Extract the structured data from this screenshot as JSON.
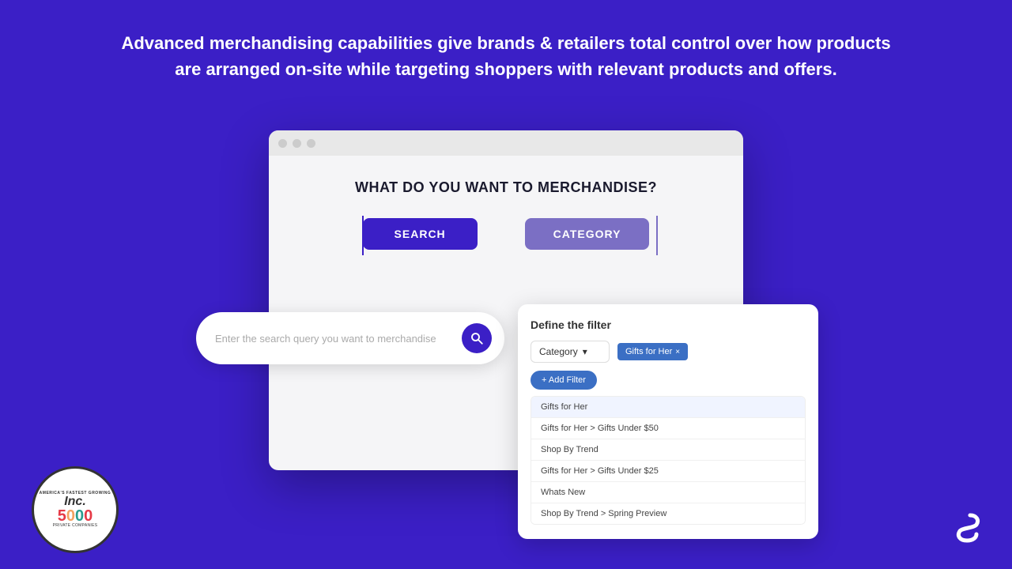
{
  "hero": {
    "text_line1": "Advanced merchandising capabilities give brands & retailers total control over how products",
    "text_line2": "are arranged on-site while targeting shoppers with relevant products and offers."
  },
  "browser": {
    "title": "WHAT DO YOU WANT TO MERCHANDISE?",
    "search_button": "SEARCH",
    "category_button": "CATEGORY"
  },
  "search_panel": {
    "placeholder": "Enter the search query you want to merchandise"
  },
  "filter_panel": {
    "title": "Define the filter",
    "dropdown_label": "Category",
    "tag_label": "Gifts for Her",
    "add_filter_label": "+ Add Filter",
    "list_items": [
      "Gifts for Her",
      "Gifts for Her > Gifts Under $50",
      "Shop By Trend",
      "Gifts for Her > Gifts Under $25",
      "Whats New",
      "Shop By Trend > Spring Preview"
    ]
  },
  "inc_badge": {
    "line1": "AMERICA'S FASTEST GROWING",
    "line2": "PRIVATE COMPANIES",
    "inc": "Inc.",
    "number": "5000"
  },
  "logo": {
    "name": "company-logo"
  },
  "colors": {
    "brand_purple": "#3B1FC6",
    "medium_purple": "#7B6FC4",
    "filter_blue": "#3B6FC4"
  }
}
